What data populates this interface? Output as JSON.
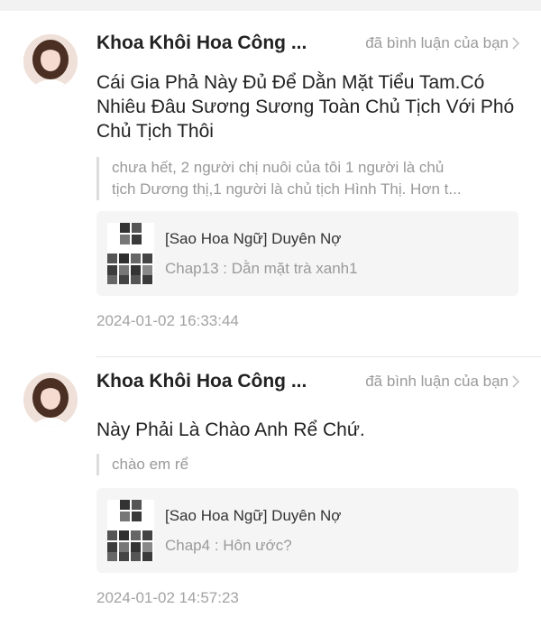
{
  "comments": [
    {
      "user_name": "Khoa Khôi Hoa Công ...",
      "action": "đã bình luận của bạn",
      "comment": "Cái Gia Phả Này Đủ Để Dằn Mặt Tiểu Tam.Có Nhiêu Đâu Sương Sương Toàn Chủ Tịch Với Phó Chủ Tịch Thôi",
      "quote_lines": [
        "chưa hết, 2 người chị nuôi của tôi 1 người là chủ",
        "tịch Dương thị,1 người là chủ tịch Hình Thị. Hơn t..."
      ],
      "story_title": "[Sao Hoa Ngữ] Duyên Nợ",
      "chapter": "Chap13 : Dằn mặt trà xanh1",
      "timestamp": "2024-01-02 16:33:44"
    },
    {
      "user_name": "Khoa Khôi Hoa Công ...",
      "action": "đã bình luận của bạn",
      "comment": "Này Phải Là Chào Anh Rể Chứ.",
      "quote_lines": [
        "chào em rể"
      ],
      "story_title": "[Sao Hoa Ngữ] Duyên Nợ",
      "chapter": "Chap4 : Hôn ước?",
      "timestamp": "2024-01-02 14:57:23"
    }
  ],
  "icons": {
    "avatar": "user-avatar",
    "chevron": "chevron-right-icon",
    "cover": "story-cover-collage"
  },
  "colors": {
    "name": "#222222",
    "muted": "#9a9a9a",
    "card_bg": "#f5f5f5",
    "quote_bar": "#dddddd"
  }
}
